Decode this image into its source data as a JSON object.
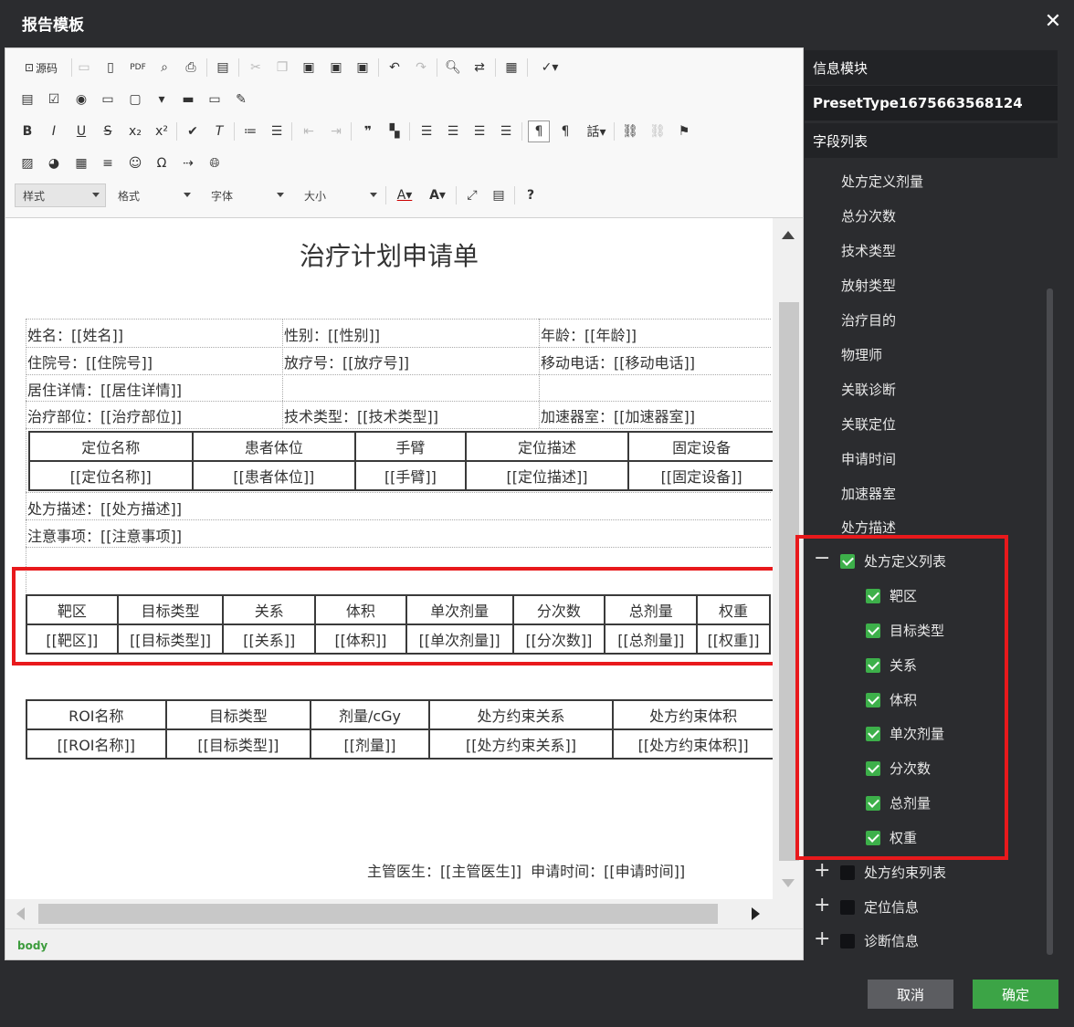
{
  "dialog": {
    "title": "报告模板",
    "close_icon": "close-icon"
  },
  "toolbar": {
    "source_label": "源码",
    "combos": {
      "style": "样式",
      "format": "格式",
      "font": "字体",
      "size": "大小"
    }
  },
  "document": {
    "title": "治疗计划申请单",
    "info_rows": [
      [
        "姓名：[[姓名]]",
        "性别：[[性别]]",
        "年龄：[[年龄]]"
      ],
      [
        "住院号：[[住院号]]",
        "放疗号：[[放疗号]]",
        "移动电话：[[移动电话]]"
      ],
      [
        "居住详情：[[居住详情]]",
        "",
        ""
      ],
      [
        "治疗部位：[[治疗部位]]",
        "技术类型：[[技术类型]]",
        "加速器室：[[加速器室]]"
      ]
    ],
    "position_table": {
      "headers": [
        "定位名称",
        "患者体位",
        "手臂",
        "定位描述",
        "固定设备"
      ],
      "values": [
        "[[定位名称]]",
        "[[患者体位]]",
        "[[手臂]]",
        "[[定位描述]]",
        "[[固定设备]]"
      ]
    },
    "rx_desc": "处方描述：[[处方描述]]",
    "notes": "注意事项：[[注意事项]]",
    "rx_table": {
      "headers": [
        "靶区",
        "目标类型",
        "关系",
        "体积",
        "单次剂量",
        "分次数",
        "总剂量",
        "权重"
      ],
      "values": [
        "[[靶区]]",
        "[[目标类型]]",
        "[[关系]]",
        "[[体积]]",
        "[[单次剂量]]",
        "[[分次数]]",
        "[[总剂量]]",
        "[[权重]]"
      ]
    },
    "roi_table": {
      "headers": [
        "ROI名称",
        "目标类型",
        "剂量/cGy",
        "处方约束关系",
        "处方约束体积"
      ],
      "values": [
        "[[ROI名称]]",
        "[[目标类型]]",
        "[[剂量]]",
        "[[处方约束关系]]",
        "[[处方约束体积]]"
      ]
    },
    "footer": "主管医生：[[主管医生]]  申请时间：[[申请时间]]"
  },
  "statusbar": {
    "path": "body"
  },
  "panel": {
    "header_info": "信息模块",
    "preset": "PresetType1675663568124",
    "header_fields": "字段列表",
    "fields": [
      "处方定义剂量",
      "总分次数",
      "技术类型",
      "放射类型",
      "治疗目的",
      "物理师",
      "关联诊断",
      "关联定位",
      "申请时间",
      "加速器室",
      "处方描述"
    ],
    "group_rx": {
      "label": "处方定义列表",
      "children": [
        "靶区",
        "目标类型",
        "关系",
        "体积",
        "单次剂量",
        "分次数",
        "总剂量",
        "权重"
      ]
    },
    "collapsed_groups": [
      "处方约束列表",
      "定位信息",
      "诊断信息"
    ]
  },
  "buttons": {
    "cancel": "取消",
    "ok": "确定"
  },
  "colors": {
    "accent_green": "#3ca446",
    "highlight_red": "#e8191c"
  }
}
